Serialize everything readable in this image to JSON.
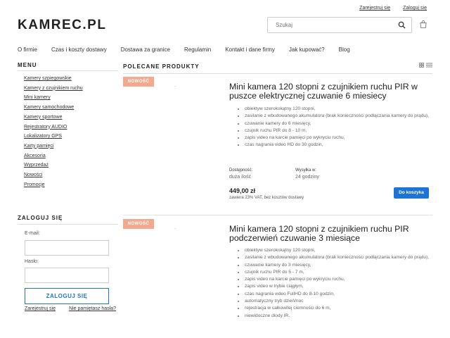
{
  "toplinks": {
    "register": "Zarejestruj się",
    "login": "Zaloguj się"
  },
  "logo": "KAMREC.PL",
  "search": {
    "placeholder": "Szukaj"
  },
  "icons": {
    "search": "search-icon",
    "cart": "shopping-bag-icon",
    "grid": "grid-view-icon",
    "list": "list-view-icon"
  },
  "nav": [
    "O firmie",
    "Czas i koszty dostawy",
    "Dostawa za granice",
    "Regulamin",
    "Kontakt i dane firmy",
    "Jak kupować?",
    "Blog"
  ],
  "sidebar": {
    "title": "MENU",
    "items": [
      "Kamery szpiegowskie",
      "Kamery z czujnikiem ruchu",
      "Mini kamery",
      "Kamery samochodowe",
      "Kamery sportowe",
      "Rejestratory AUDIO",
      "Lokalizatory GPS",
      "Karty pamięci",
      "Akcesoria",
      "Wyprzedaż",
      "Nowości",
      "Promocje"
    ]
  },
  "login": {
    "title": "ZALOGUJ SIĘ",
    "email_label": "E-mail:",
    "password_label": "Hasło:",
    "button": "ZALOGUJ SIĘ",
    "register": "Zarejestruj się",
    "forgot": "Nie pamiętasz hasła?"
  },
  "main": {
    "title": "POLECANE PRODUKTY",
    "products": [
      {
        "badge": "NOWOŚĆ",
        "thumb": ".",
        "title": "Mini kamera 120 stopni z czujnikiem ruchu PIR w puszce elektrycznej czuwanie 6 miesiecy",
        "features": [
          "obiektyw szerokokątny 120 stopni,",
          "zasilanie z wbudowanego akumulatora (brak konieczności podłączania kamery do prądu),",
          "czuwanie kamery do 6 miesięcy,",
          "czujnik ruchu PIR do 8 - 10 m,",
          "zapis video na karcie pamięci po wykryciu ruchu,",
          "czas nagrania video HD do 30 godzin,"
        ],
        "availability_label": "Dostępność:",
        "availability": "duża ilość",
        "shipping_label": "Wysyłka w:",
        "shipping": "24 godziny",
        "price": "449,00 zł",
        "vat": "zawiera 23% VAT, bez kosztów dostawy",
        "cart_button": "Do koszyka"
      },
      {
        "badge": "NOWOŚĆ",
        "thumb": ".",
        "title": "Mini kamera 120 stopni z czujnikiem ruchu PIR podczerwień czuwanie 3 miesiące",
        "features": [
          "obiektyw szerokokątny 120 stopni,",
          "zasilanie z wbudowanego akumulatora (brak konieczności podłączania kamery do prądu),",
          "czuwanie kamery do 3 miesięcy,",
          "czujnik ruchu PIR do 5 - 7 m,",
          "zapis video na karcie pamięci po wykryciu ruchu,",
          "zapis video w trybie ciągłym,",
          "czas nagrania video FullHD do 8-10 godzin,",
          "automatyczny tryb dzień/noc",
          "rejestracja w całkowitej ciemności do 6 m,",
          "niewidoczne diody IR."
        ]
      }
    ]
  },
  "colors": {
    "accent": "#1e74d6",
    "badge": "#f4a98f"
  }
}
